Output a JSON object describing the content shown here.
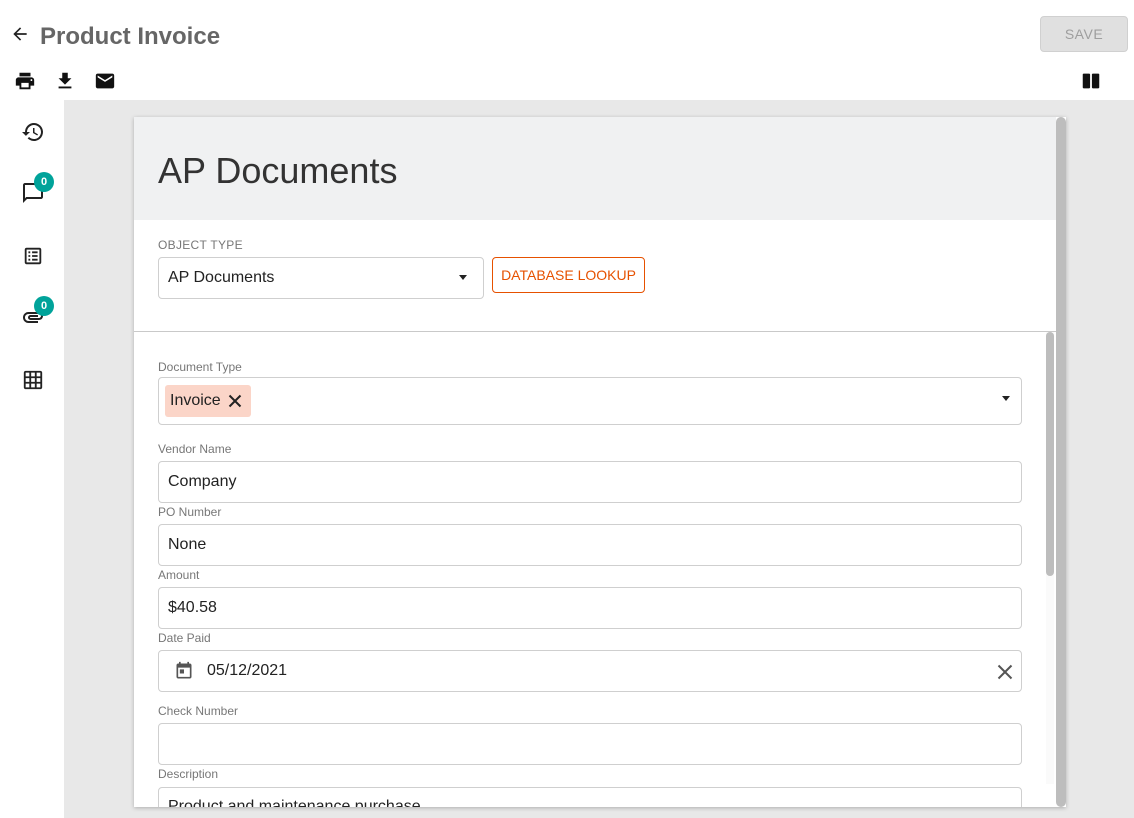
{
  "header": {
    "title": "Product Invoice",
    "save_label": "SAVE"
  },
  "toolbar": {
    "icons": [
      "print-icon",
      "download-icon",
      "email-icon"
    ],
    "layout_icon": "split-view-icon"
  },
  "sidebar": {
    "items": [
      {
        "icon": "history-icon"
      },
      {
        "icon": "comment-icon",
        "badge": "0"
      },
      {
        "icon": "list-icon"
      },
      {
        "icon": "attachment-icon",
        "badge": "0"
      },
      {
        "icon": "grid-icon"
      }
    ]
  },
  "card": {
    "title": "AP Documents",
    "object_type_label": "OBJECT TYPE",
    "object_type_value": "AP Documents",
    "database_lookup_label": "DATABASE LOOKUP"
  },
  "fields": {
    "document_type": {
      "label": "Document Type",
      "chip": "Invoice"
    },
    "vendor_name": {
      "label": "Vendor Name",
      "value": "Company"
    },
    "po_number": {
      "label": "PO Number",
      "value": "None"
    },
    "amount": {
      "label": "Amount",
      "value": "$40.58"
    },
    "date_paid": {
      "label": "Date Paid",
      "value": "05/12/2021"
    },
    "check_number": {
      "label": "Check Number",
      "value": ""
    },
    "description": {
      "label": "Description",
      "value": "Product and maintenance purchase"
    }
  },
  "colors": {
    "accent": "#e65100",
    "badge": "#00a39a",
    "chip": "#fbd5c8"
  }
}
